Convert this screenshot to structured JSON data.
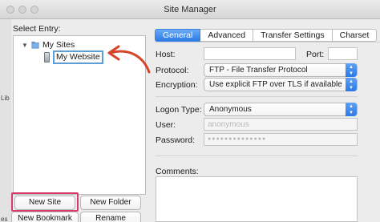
{
  "window": {
    "title": "Site Manager"
  },
  "tree": {
    "header": "Select Entry:",
    "root_label": "My Sites",
    "new_site_label": "My Website"
  },
  "buttons": {
    "new_site": "New Site",
    "new_folder": "New Folder",
    "new_bookmark": "New Bookmark",
    "rename": "Rename"
  },
  "tabs": [
    "General",
    "Advanced",
    "Transfer Settings",
    "Charset"
  ],
  "form": {
    "host_label": "Host:",
    "port_label": "Port:",
    "protocol_label": "Protocol:",
    "protocol_value": "FTP - File Transfer Protocol",
    "encryption_label": "Encryption:",
    "encryption_value": "Use explicit FTP over TLS if available",
    "logon_label": "Logon Type:",
    "logon_value": "Anonymous",
    "user_label": "User:",
    "user_value": "anonymous",
    "password_label": "Password:",
    "password_value": "●●●●●●●●●●●●●●",
    "comments_label": "Comments:"
  },
  "background_fragments": [
    "Lib",
    "es"
  ],
  "colors": {
    "accent": "#2c7be8",
    "annotation": "#d63c6a"
  },
  "icons": [
    "folder-icon",
    "server-icon",
    "disclosure-icon",
    "chevron-updown-icon",
    "annotation-arrow-icon"
  ]
}
